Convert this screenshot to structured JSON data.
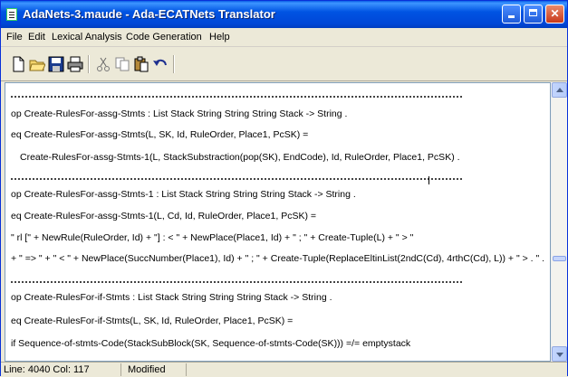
{
  "window": {
    "title": "AdaNets-3.maude - Ada-ECATNets Translator"
  },
  "menu": [
    "File",
    "Edit",
    "Lexical Analysis",
    "Code Generation",
    "Help"
  ],
  "toolbar": [
    "new-file-icon",
    "open-folder-icon",
    "save-icon",
    "print-icon",
    "cut-icon",
    "copy-icon",
    "paste-icon",
    "undo-icon"
  ],
  "editor": {
    "lines": [
      "op Create-RulesFor-assg-Stmts : List Stack String String String Stack  -> String .",
      "eq Create-RulesFor-assg-Stmts(L, SK, Id, RuleOrder, Place1, PcSK) =",
      "Create-RulesFor-assg-Stmts-1(L, StackSubstraction(pop(SK), EndCode), Id, RuleOrder, Place1, PcSK) .",
      "op Create-RulesFor-assg-Stmts-1  : List Stack String String String Stack -> String .",
      "eq Create-RulesFor-assg-Stmts-1(L, Cd, Id, RuleOrder, Place1, PcSK) =",
      "\" rl [\" + NewRule(RuleOrder, Id) + \"] : < \" + NewPlace(Place1, Id) + \" ; \" + Create-Tuple(L) + \" > \"",
      "+ \" => \" + \" < \" + NewPlace(SuccNumber(Place1), Id) + \" ; \" + Create-Tuple(ReplaceEltinList(2ndC(Cd), 4rthC(Cd), L)) + \" > . \" .",
      "op Create-RulesFor-if-Stmts : List Stack String String String Stack -> String .",
      "eq Create-RulesFor-if-Stmts(L, SK, Id, RuleOrder, Place1, PcSK) =",
      "if Sequence-of-stmts-Code(StackSubBlock(SK, Sequence-of-stmts-Code(SK))) =/= emptystack"
    ]
  },
  "status": {
    "position": "Line: 4040  Col: 117",
    "state": "Modified"
  }
}
